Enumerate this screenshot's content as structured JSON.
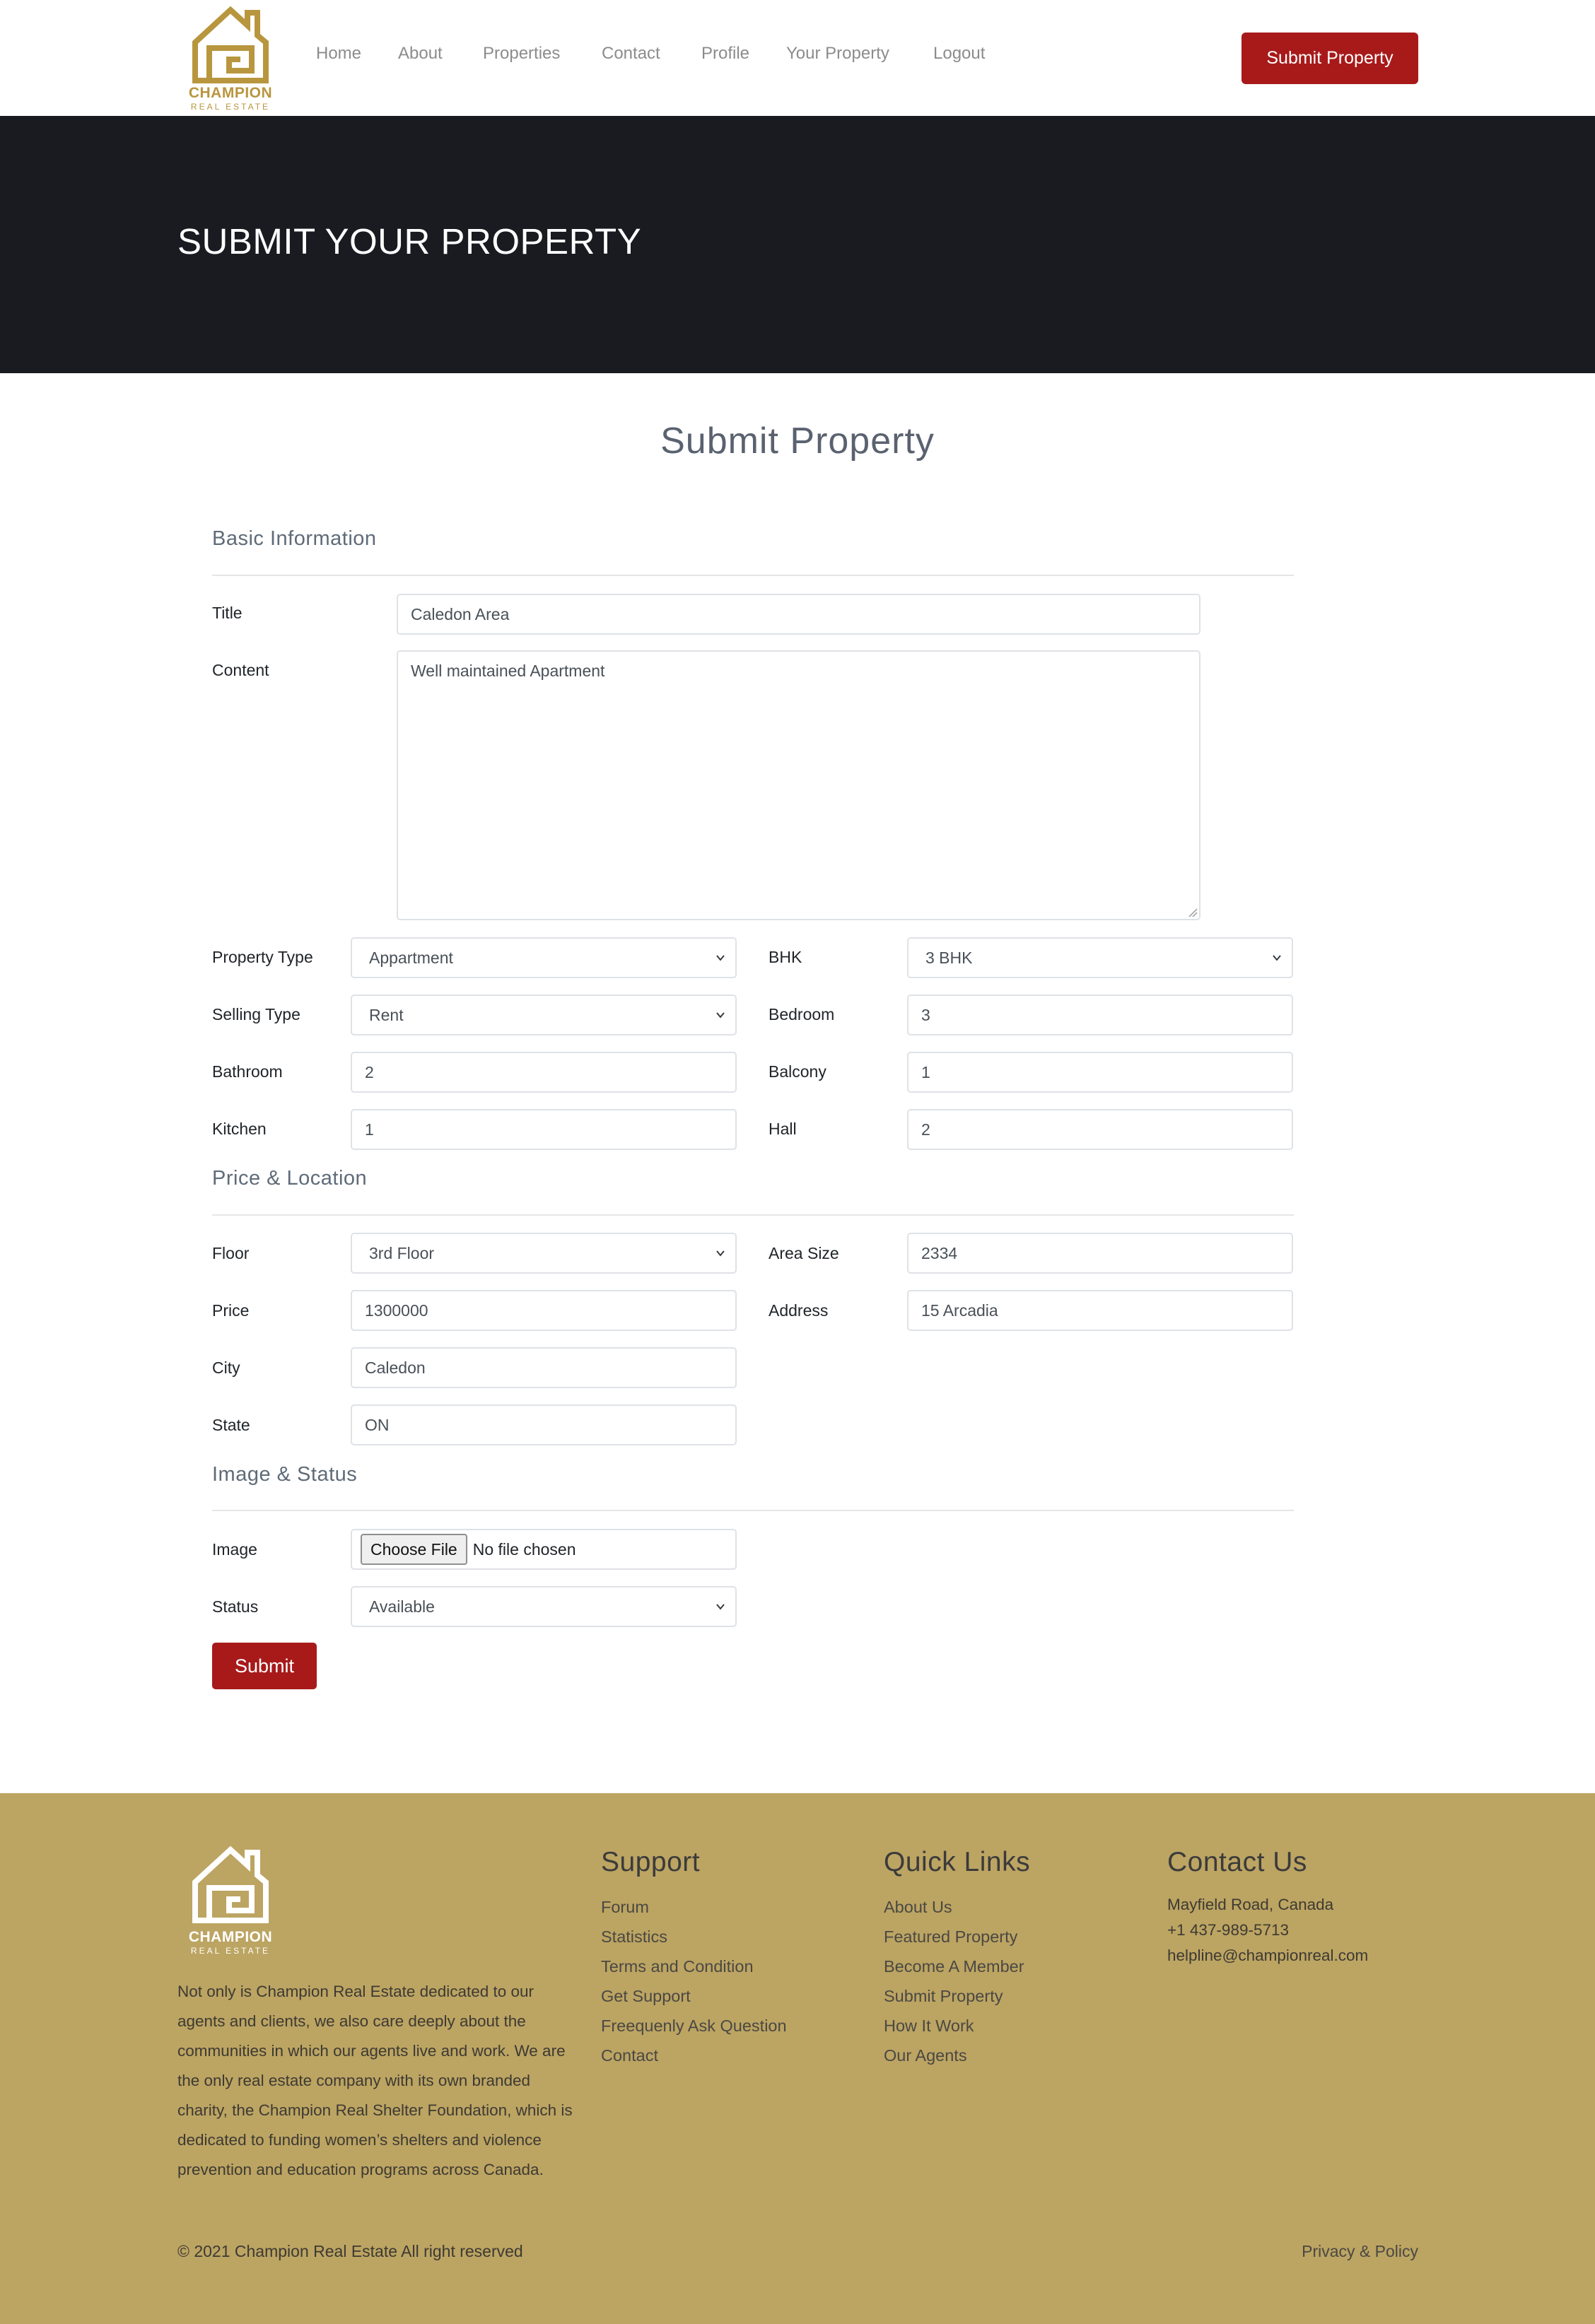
{
  "brand": {
    "name": "CHAMPION",
    "tagline": "REAL ESTATE",
    "accent": "#a81a1a",
    "gold": "#b8963e",
    "footer_bg": "#bca462"
  },
  "nav": {
    "items": [
      "Home",
      "About",
      "Properties",
      "Contact",
      "Profile",
      "Your Property",
      "Logout"
    ],
    "cta": "Submit Property"
  },
  "banner": {
    "title": "SUBMIT YOUR PROPERTY"
  },
  "form": {
    "heading": "Submit Property",
    "sections": {
      "basic": "Basic Information",
      "price": "Price & Location",
      "image": "Image & Status"
    },
    "fields": {
      "title": {
        "label": "Title",
        "value": "Caledon Area"
      },
      "content": {
        "label": "Content",
        "value": "Well maintained Apartment"
      },
      "property_type": {
        "label": "Property Type",
        "value": "Appartment"
      },
      "bhk": {
        "label": "BHK",
        "value": "3 BHK"
      },
      "selling_type": {
        "label": "Selling Type",
        "value": "Rent"
      },
      "bedroom": {
        "label": "Bedroom",
        "value": "3"
      },
      "bathroom": {
        "label": "Bathroom",
        "value": "2"
      },
      "balcony": {
        "label": "Balcony",
        "value": "1"
      },
      "kitchen": {
        "label": "Kitchen",
        "value": "1"
      },
      "hall": {
        "label": "Hall",
        "value": "2"
      },
      "floor": {
        "label": "Floor",
        "value": "3rd Floor"
      },
      "area_size": {
        "label": "Area Size",
        "value": "2334"
      },
      "price": {
        "label": "Price",
        "value": "1300000"
      },
      "address": {
        "label": "Address",
        "value": "15 Arcadia"
      },
      "city": {
        "label": "City",
        "value": "Caledon"
      },
      "state": {
        "label": "State",
        "value": "ON"
      },
      "image": {
        "label": "Image",
        "button": "Choose File",
        "status": "No file chosen"
      },
      "status": {
        "label": "Status",
        "value": "Available"
      }
    },
    "submit": "Submit"
  },
  "footer": {
    "about": "Not only is Champion Real Estate dedicated to our agents and clients, we also care deeply about the communities in which our agents live and work. We are the only real estate company with its own branded charity, the Champion Real Shelter Foundation, which is dedicated to funding women’s shelters and violence prevention and education programs across Canada.",
    "support": {
      "title": "Support",
      "links": [
        "Forum",
        "Statistics",
        "Terms and Condition",
        "Get Support",
        "Freequenly Ask Question",
        "Contact"
      ]
    },
    "quick_links": {
      "title": "Quick Links",
      "links": [
        "About Us",
        "Featured Property",
        "Become A Member",
        "Submit Property",
        "How It Work",
        "Our Agents"
      ]
    },
    "contact": {
      "title": "Contact Us",
      "address": "Mayfield Road, Canada",
      "phone": "+1 437-989-5713",
      "email": "helpline@championreal.com"
    },
    "copyright": "© 2021 Champion Real Estate All right reserved",
    "privacy": "Privacy & Policy"
  }
}
